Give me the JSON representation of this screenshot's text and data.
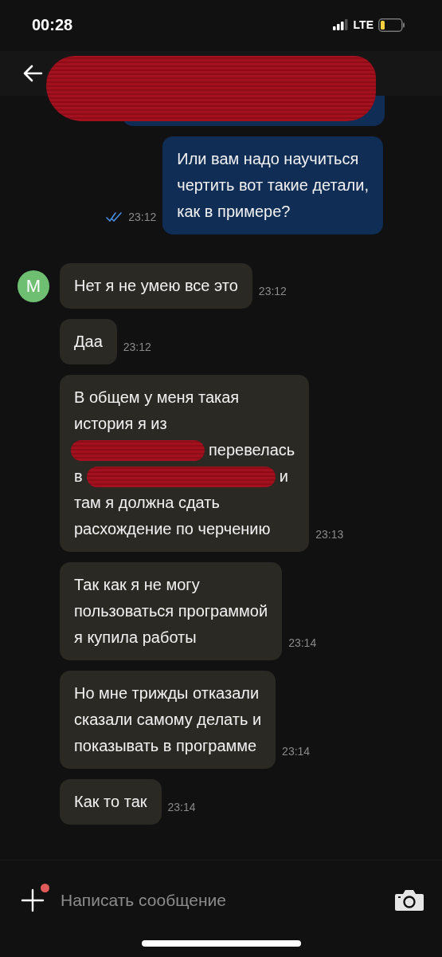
{
  "status_bar": {
    "time": "00:28",
    "network": "LTE"
  },
  "header": {
    "title_redacted": true
  },
  "messages": [
    {
      "kind": "partial"
    },
    {
      "kind": "sent",
      "text": "Или вам надо научиться\nчертить вот такие детали,\nкак в примере?",
      "time": "23:12",
      "read": true
    },
    {
      "kind": "received",
      "avatar": "M",
      "text": "Нет я не умею все это",
      "time": "23:12"
    },
    {
      "kind": "received",
      "text": "Даа",
      "time": "23:12"
    },
    {
      "kind": "received_redacted",
      "lines": [
        [
          {
            "kind": "text",
            "text": "В общем у меня такая"
          }
        ],
        [
          {
            "kind": "text",
            "text": "история я из"
          }
        ],
        [
          {
            "kind": "redaction"
          },
          {
            "kind": "text",
            "text": "перевелась"
          }
        ],
        [
          {
            "kind": "text",
            "text": "в"
          },
          {
            "kind": "redaction"
          },
          {
            "kind": "text",
            "text": "и"
          }
        ],
        [
          {
            "kind": "text",
            "text": "там я должна сдать"
          }
        ],
        [
          {
            "kind": "text",
            "text": "расхождение по черчению"
          }
        ]
      ],
      "time": "23:13"
    },
    {
      "kind": "received",
      "text": "Так как я не могу\nпользоваться программой\nя купила работы",
      "time": "23:14"
    },
    {
      "kind": "received",
      "text": "Но мне трижды отказали\nсказали самому делать и\nпоказывать в программе",
      "time": "23:14"
    },
    {
      "kind": "received",
      "text": "Как то так",
      "time": "23:14"
    }
  ],
  "composer": {
    "placeholder": "Написать сообщение",
    "attach_badge": true
  }
}
